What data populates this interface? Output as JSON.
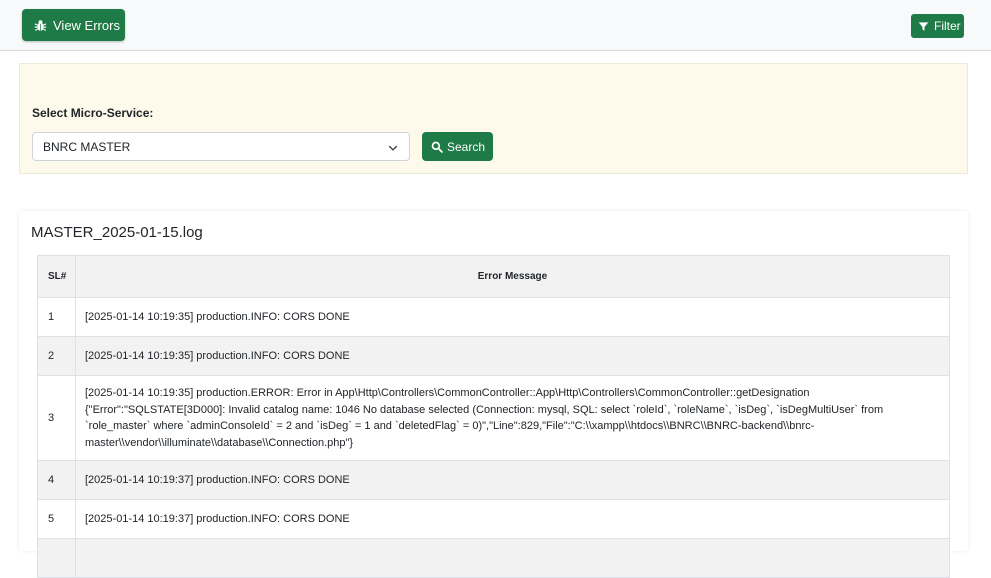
{
  "header": {
    "view_errors_label": "View Errors",
    "filter_label": "Filter"
  },
  "filter_panel": {
    "label": "Select Micro-Service:",
    "selected_service": "BNRC MASTER",
    "search_label": "Search"
  },
  "log": {
    "title": "MASTER_2025-01-15.log",
    "columns": [
      "SL#",
      "Error Message"
    ],
    "rows": [
      {
        "sl": "1",
        "message": "[2025-01-14 10:19:35] production.INFO: CORS DONE"
      },
      {
        "sl": "2",
        "message": "[2025-01-14 10:19:35] production.INFO: CORS DONE"
      },
      {
        "sl": "3",
        "message": "[2025-01-14 10:19:35] production.ERROR: Error in App\\Http\\Controllers\\CommonController::App\\Http\\Controllers\\CommonController::getDesignation {\"Error\":\"SQLSTATE[3D000]: Invalid catalog name: 1046 No database selected (Connection: mysql, SQL: select `roleId`, `roleName`, `isDeg`, `isDegMultiUser` from `role_master` where `adminConsoleId` = 2 and `isDeg` = 1 and `deletedFlag` = 0)\",\"Line\":829,\"File\":\"C:\\\\xampp\\\\htdocs\\\\BNRC\\\\BNRC-backend\\\\bnrc-master\\\\vendor\\\\illuminate\\\\database\\\\Connection.php\"}"
      },
      {
        "sl": "4",
        "message": "[2025-01-14 10:19:37] production.INFO: CORS DONE"
      },
      {
        "sl": "5",
        "message": "[2025-01-14 10:19:37] production.INFO: CORS DONE"
      },
      {
        "sl": "",
        "message": ""
      }
    ]
  },
  "colors": {
    "primary_green": "#1e7a46",
    "panel_background": "#fdfaeb",
    "table_stripe": "#f2f2f2"
  },
  "icons": {
    "view_errors": "bug-icon",
    "filter": "filter-icon",
    "select": "chevron-down-icon",
    "search": "search-icon"
  }
}
